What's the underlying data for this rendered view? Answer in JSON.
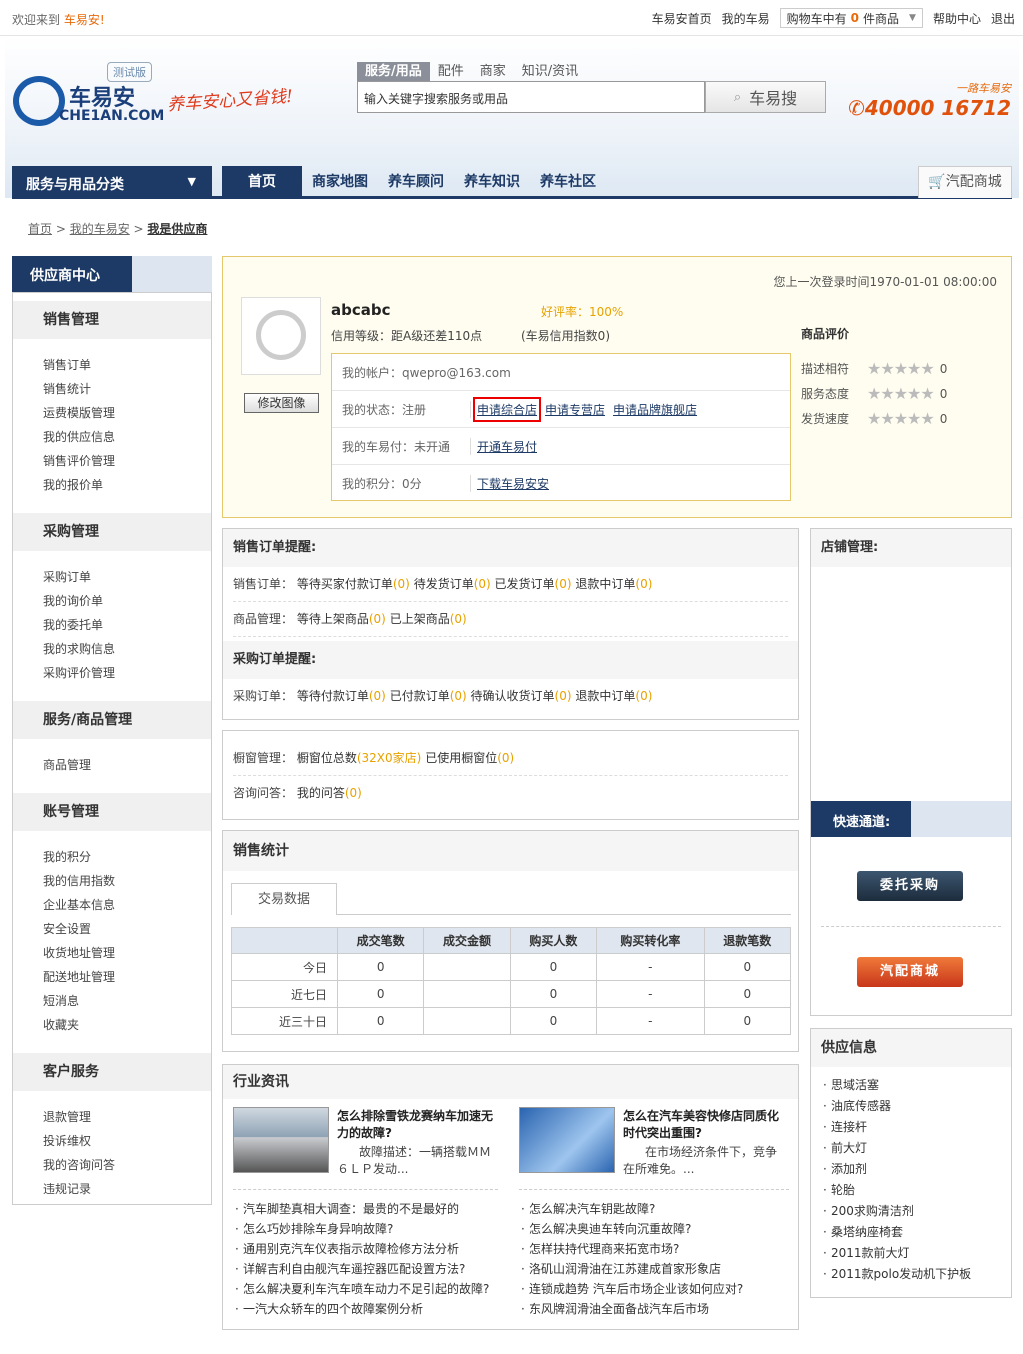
{
  "topbar": {
    "welcome": "欢迎来到",
    "brand": "车易安!",
    "links": [
      "车易安首页",
      "我的车易",
      "帮助中心",
      "退出"
    ],
    "cart_prefix": "购物车中有",
    "cart_count": "0",
    "cart_suffix": "件商品"
  },
  "header": {
    "logo_cn": "车易安",
    "logo_en": "CHE1AN.COM",
    "beta": "测试版",
    "slogan": "养车安心又省钱!",
    "search_tabs": [
      "服务/用品",
      "配件",
      "商家",
      "知识/资讯"
    ],
    "search_placeholder": "输入关键字搜索服务或用品",
    "search_button": "车易搜",
    "phone_tag": "一路车易安",
    "phone": "40000 16712"
  },
  "nav": {
    "category": "服务与用品分类",
    "home": "首页",
    "items": [
      "商家地图",
      "养车顾问",
      "养车知识",
      "养车社区"
    ],
    "mall": "汽配商城"
  },
  "breadcrumb": [
    "首页",
    "我的车易安",
    "我是供应商"
  ],
  "sidebar": {
    "title": "供应商中心",
    "groups": [
      {
        "title": "销售管理",
        "items": [
          "销售订单",
          "销售统计",
          "运费模版管理",
          "我的供应信息",
          "销售评价管理",
          "我的报价单"
        ]
      },
      {
        "title": "采购管理",
        "items": [
          "采购订单",
          "我的询价单",
          "我的委托单",
          "我的求购信息",
          "采购评价管理"
        ]
      },
      {
        "title": "服务/商品管理",
        "items": [
          "商品管理"
        ]
      },
      {
        "title": "账号管理",
        "items": [
          "我的积分",
          "我的信用指数",
          "企业基本信息",
          "安全设置",
          "收货地址管理",
          "配送地址管理",
          "短消息",
          "收藏夹"
        ]
      },
      {
        "title": "客户服务",
        "items": [
          "退款管理",
          "投诉维权",
          "我的咨询问答",
          "违规记录"
        ]
      }
    ]
  },
  "profile": {
    "last_login": "您上一次登录时间1970-01-01 08:00:00",
    "username": "abcabc",
    "good_rate": "好评率：100%",
    "credit": "信用等级：距A级还差110点",
    "credit_index": "(车易信用指数0)",
    "edit_avatar": "修改图像",
    "account_label": "我的帐户：qwepro@163.com",
    "status_label": "我的状态：注册",
    "status_links": [
      "申请综合店",
      "申请专营店",
      "申请品牌旗舰店"
    ],
    "pay_label": "我的车易付：未开通",
    "pay_link": "开通车易付",
    "points_label": "我的积分：0分",
    "points_link": "下载车易安安"
  },
  "rating": {
    "title": "商品评价",
    "rows": [
      {
        "label": "描述相符",
        "score": "0"
      },
      {
        "label": "服务态度",
        "score": "0"
      },
      {
        "label": "发货速度",
        "score": "0"
      }
    ]
  },
  "sales_reminder": {
    "title": "销售订单提醒:",
    "orders_label": "销售订单：",
    "orders": [
      {
        "t": "等待买家付款订单",
        "n": "(0)"
      },
      {
        "t": "待发货订单",
        "n": "(0)"
      },
      {
        "t": "已发货订单",
        "n": "(0)"
      },
      {
        "t": "退款中订单",
        "n": "(0)"
      }
    ],
    "goods_label": "商品管理：",
    "goods": [
      {
        "t": "等待上架商品",
        "n": "(0)"
      },
      {
        "t": "已上架商品",
        "n": "(0)"
      }
    ],
    "purchase_title": "采购订单提醒:",
    "purchase_label": "采购订单：",
    "purchase": [
      {
        "t": "等待付款订单",
        "n": "(0)"
      },
      {
        "t": "已付款订单",
        "n": "(0)"
      },
      {
        "t": "待确认收货订单",
        "n": "(0)"
      },
      {
        "t": "退款中订单",
        "n": "(0)"
      }
    ]
  },
  "window": {
    "label": "橱窗管理：",
    "total": "橱窗位总数",
    "total_n": "(32X0家店)",
    "used": "已使用橱窗位",
    "used_n": "(0)",
    "qa_label": "咨询问答：",
    "qa": "我的问答",
    "qa_n": "(0)"
  },
  "stats": {
    "title": "销售统计",
    "tab": "交易数据",
    "headers": [
      "",
      "成交笔数",
      "成交金额",
      "购买人数",
      "购买转化率",
      "退款笔数"
    ],
    "rows": [
      [
        "今日",
        "0",
        "",
        "0",
        "-",
        "0"
      ],
      [
        "近七日",
        "0",
        "",
        "0",
        "-",
        "0"
      ],
      [
        "近三十日",
        "0",
        "",
        "0",
        "-",
        "0"
      ]
    ]
  },
  "news": {
    "title": "行业资讯",
    "feature": [
      {
        "title": "怎么排除雪铁龙赛纳车加速无力的故障?",
        "desc": "故障描述：一辆搭载ＭＭ６ＬＰ发动..."
      },
      {
        "title": "怎么在汽车美容快修店同质化时代突出重围?",
        "desc": "在市场经济条件下，竞争在所难免。..."
      }
    ],
    "left": [
      "汽车脚垫真相大调查：最贵的不是最好的",
      "怎么巧妙排除车身异响故障?",
      "通用别克汽车仪表指示故障检修方法分析",
      "详解吉利自由舰汽车遥控器匹配设置方法?",
      "怎么解决夏利车汽车喷车动力不足引起的故障?",
      "一汽大众轿车的四个故障案例分析"
    ],
    "right": [
      "怎么解决汽车钥匙故障?",
      "怎么解决奥迪车转向沉重故障?",
      "怎样扶持代理商来拓宽市场?",
      "洛矶山润滑油在江苏建成首家形象店",
      "连锁成趋势 汽车后市场企业该如何应对?",
      "东风牌润滑油全面备战汽车后市场"
    ]
  },
  "store": {
    "title": "店铺管理:",
    "quick": "快速通道:",
    "btn_purchase": "委托采购",
    "btn_mall": "汽配商城"
  },
  "supply": {
    "title": "供应信息",
    "items": [
      "思域活塞",
      "油底传感器",
      "连接杆",
      "前大灯",
      "添加剂",
      "轮胎",
      "200求购清洁剂",
      "桑塔纳座椅套",
      "2011款前大灯",
      "2011款polo发动机下护板"
    ]
  },
  "colors": {
    "navy": "#1d3a66",
    "orange": "#e86a0b",
    "gold": "#e8a200",
    "red_box": "#e00000"
  }
}
